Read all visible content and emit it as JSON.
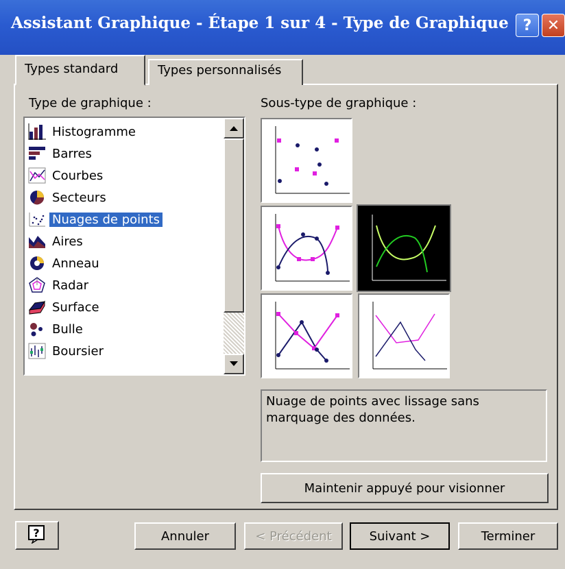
{
  "window": {
    "title": "Assistant Graphique - Étape 1 sur 4 - Type de Graphique",
    "help_glyph": "?",
    "close_glyph": "✕"
  },
  "tabs": [
    {
      "label": "Types standard",
      "active": true
    },
    {
      "label": "Types personnalisés",
      "active": false
    }
  ],
  "chart_type": {
    "label": "Type de graphique :",
    "items": [
      {
        "label": "Histogramme",
        "icon": "column-chart-icon"
      },
      {
        "label": "Barres",
        "icon": "bar-chart-icon"
      },
      {
        "label": "Courbes",
        "icon": "line-chart-icon"
      },
      {
        "label": "Secteurs",
        "icon": "pie-chart-icon"
      },
      {
        "label": "Nuages de points",
        "icon": "scatter-chart-icon",
        "selected": true
      },
      {
        "label": "Aires",
        "icon": "area-chart-icon"
      },
      {
        "label": "Anneau",
        "icon": "doughnut-chart-icon"
      },
      {
        "label": "Radar",
        "icon": "radar-chart-icon"
      },
      {
        "label": "Surface",
        "icon": "surface-chart-icon"
      },
      {
        "label": "Bulle",
        "icon": "bubble-chart-icon"
      },
      {
        "label": "Boursier",
        "icon": "stock-chart-icon"
      }
    ]
  },
  "subtype": {
    "label": "Sous-type de graphique :",
    "selected_index": 2,
    "description": "Nuage de points avec lissage sans marquage des données.",
    "preview_button": "Maintenir appuyé pour visionner"
  },
  "footer": {
    "help_glyph": "?",
    "cancel": "Annuler",
    "previous": "< Précédent",
    "next": "Suivant >",
    "finish": "Terminer"
  },
  "colors": {
    "title_bar": "#2a5bd0",
    "selection": "#316ac5",
    "magenta": "#e020e0",
    "navy": "#1a1a6a",
    "selected_line_a": "#c8ff66",
    "selected_line_b": "#22cc22"
  }
}
